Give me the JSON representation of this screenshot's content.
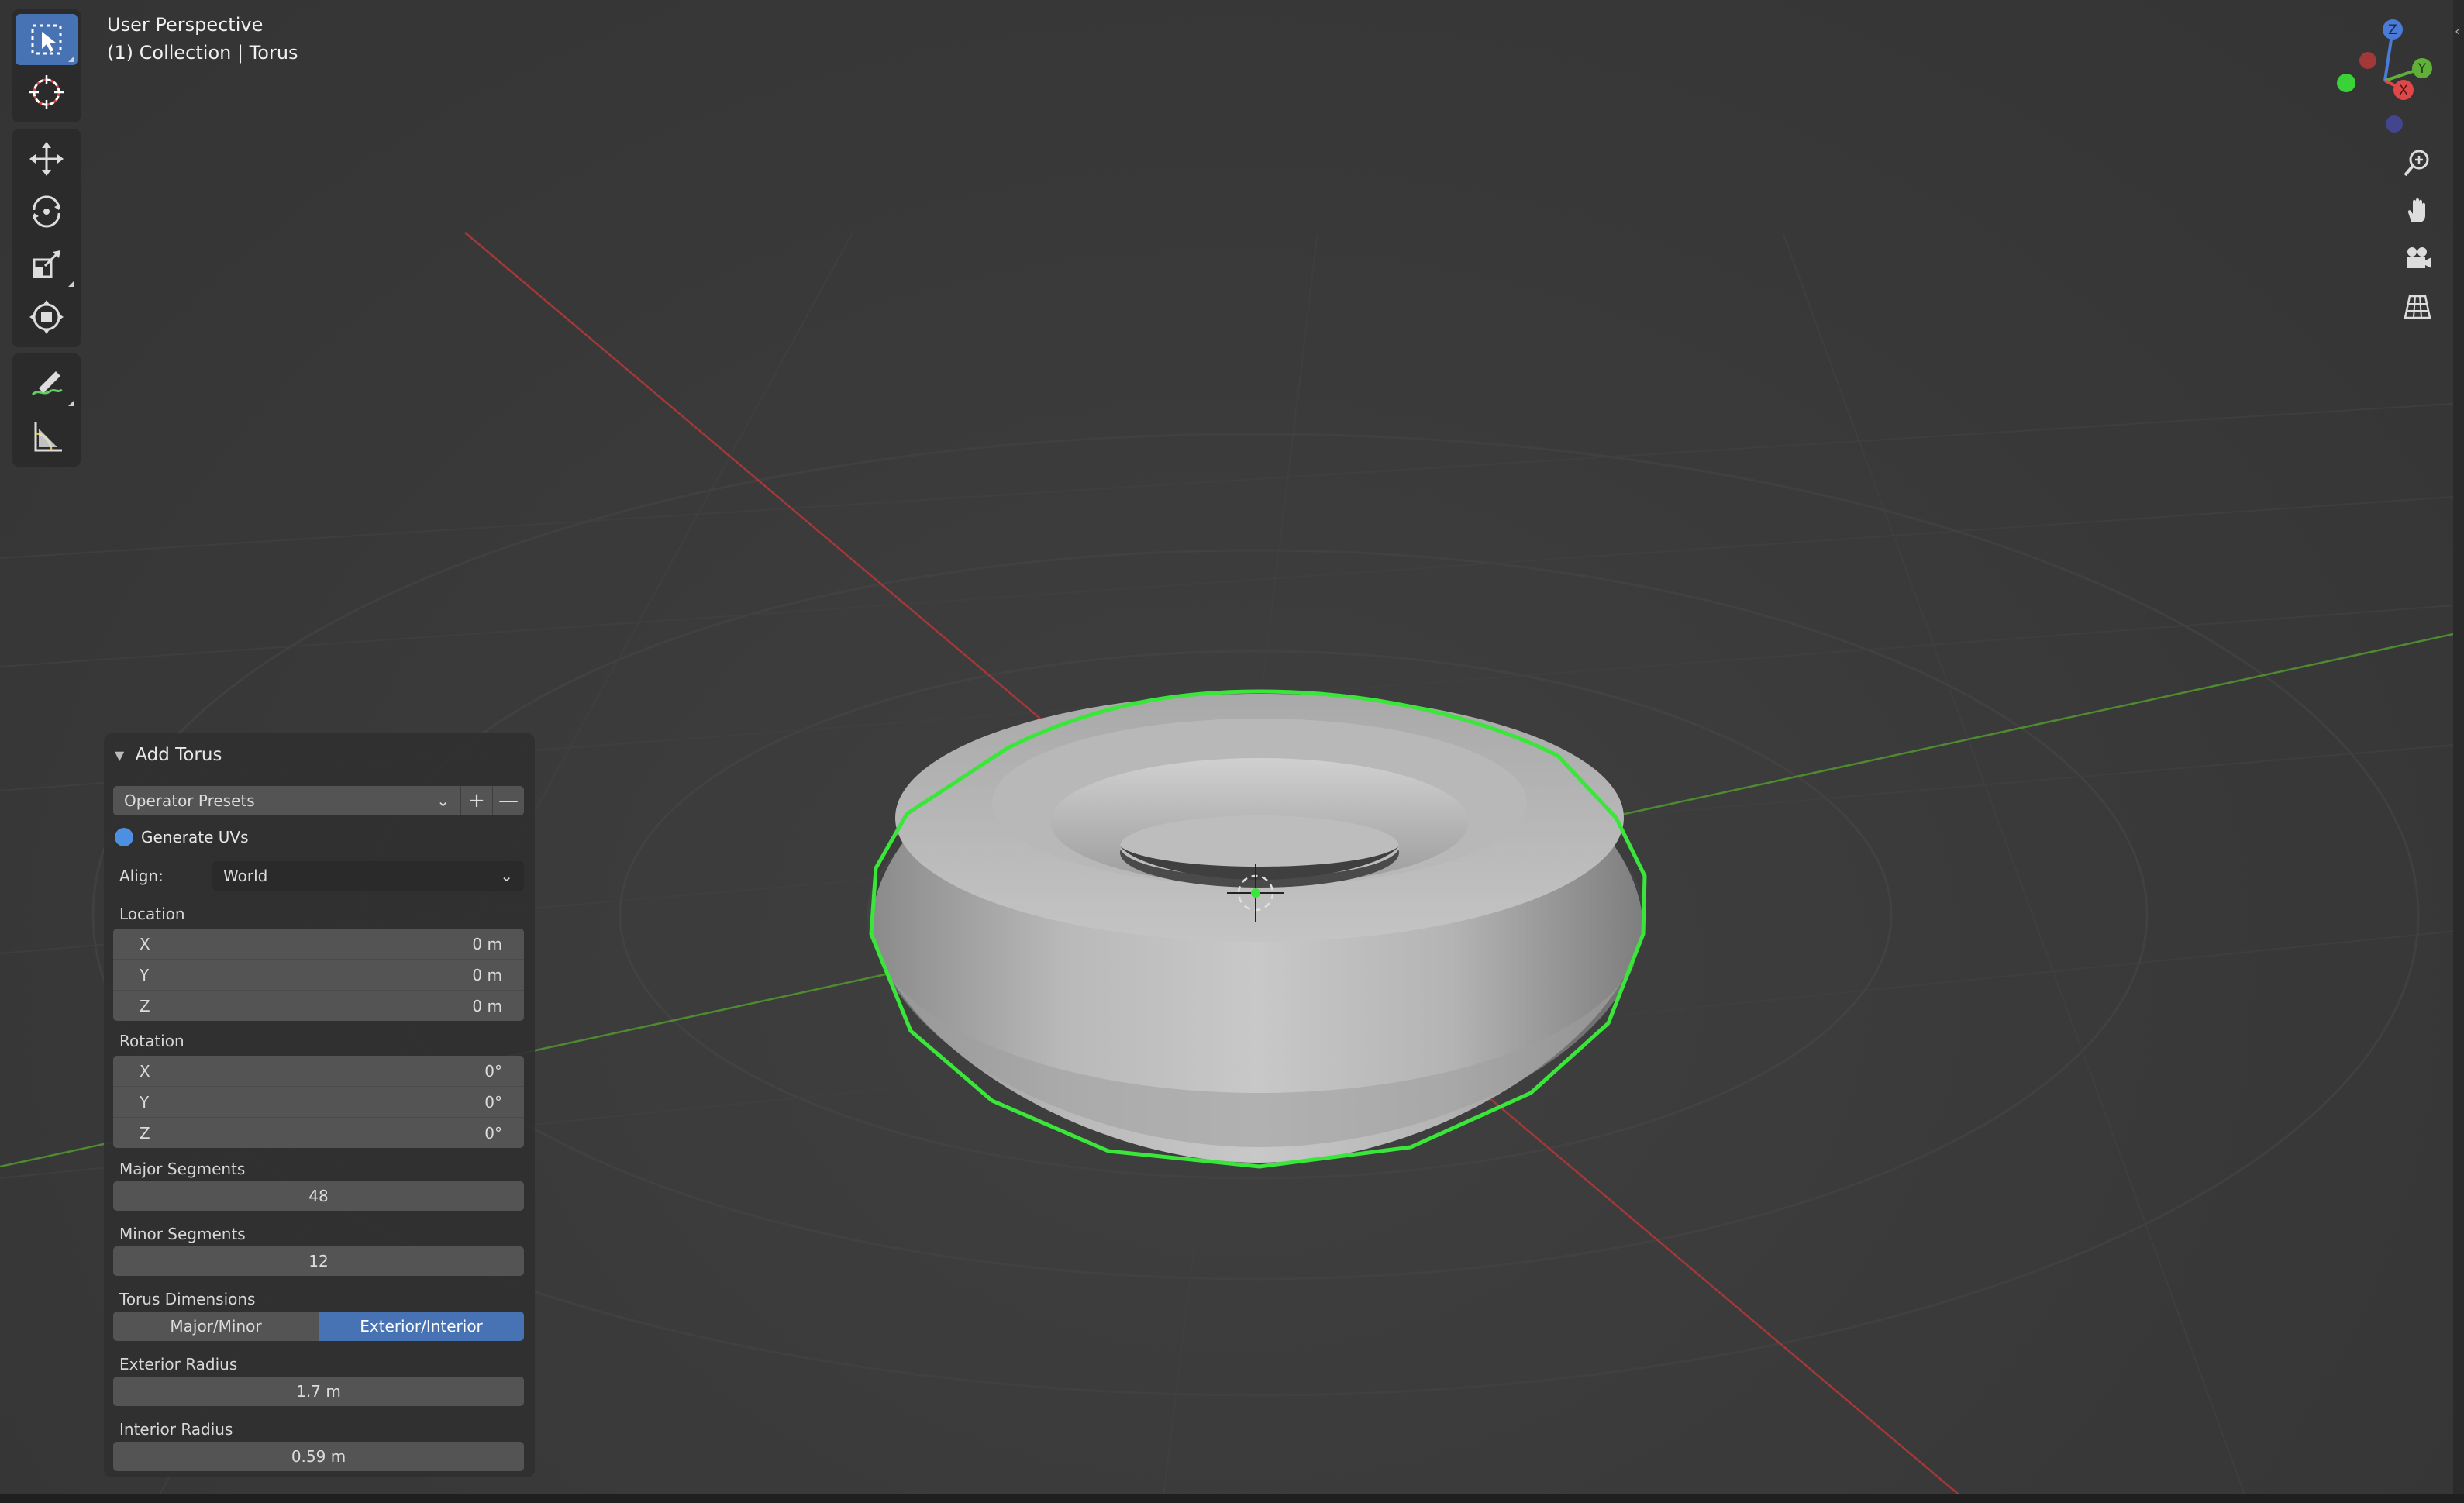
{
  "viewport": {
    "view_name": "User Perspective",
    "collection_info": "(1) Collection | Torus"
  },
  "toolbar": {
    "tools": [
      {
        "name": "select-box",
        "icon": "select-box-icon",
        "active": true
      },
      {
        "name": "cursor",
        "icon": "cursor-icon",
        "active": false
      },
      {
        "name": "move",
        "icon": "move-icon",
        "active": false
      },
      {
        "name": "rotate",
        "icon": "rotate-icon",
        "active": false
      },
      {
        "name": "scale",
        "icon": "scale-icon",
        "active": false
      },
      {
        "name": "transform",
        "icon": "transform-icon",
        "active": false
      },
      {
        "name": "annotate",
        "icon": "annotate-icon",
        "active": false
      },
      {
        "name": "measure",
        "icon": "measure-icon",
        "active": false
      }
    ]
  },
  "gizmo": {
    "axes": [
      "Z",
      "Y",
      "X"
    ],
    "colors": {
      "x": "#e04848",
      "y": "#5fb038",
      "z": "#4a7bd8"
    }
  },
  "nav_buttons": [
    "zoom-icon",
    "pan-hand-icon",
    "camera-icon",
    "grid-icon"
  ],
  "operator_panel": {
    "title": "Add Torus",
    "presets_label": "Operator Presets",
    "preset_add": "+",
    "preset_remove": "—",
    "generate_uvs_label": "Generate UVs",
    "generate_uvs": true,
    "align_label": "Align:",
    "align_value": "World",
    "location_label": "Location",
    "location": [
      {
        "axis": "X",
        "value": "0 m"
      },
      {
        "axis": "Y",
        "value": "0 m"
      },
      {
        "axis": "Z",
        "value": "0 m"
      }
    ],
    "rotation_label": "Rotation",
    "rotation": [
      {
        "axis": "X",
        "value": "0°"
      },
      {
        "axis": "Y",
        "value": "0°"
      },
      {
        "axis": "Z",
        "value": "0°"
      }
    ],
    "major_segments_label": "Major Segments",
    "major_segments": "48",
    "minor_segments_label": "Minor Segments",
    "minor_segments": "12",
    "torus_dimensions_label": "Torus Dimensions",
    "dimension_modes": [
      "Major/Minor",
      "Exterior/Interior"
    ],
    "dimension_mode_selected": "Exterior/Interior",
    "exterior_radius_label": "Exterior Radius",
    "exterior_radius": "1.7 m",
    "interior_radius_label": "Interior Radius",
    "interior_radius": "0.59 m"
  },
  "colors": {
    "accent": "#4772b3",
    "selection_outline": "#39e639",
    "x_axis_line": "#a33838",
    "y_axis_line": "#4e8a2f"
  }
}
